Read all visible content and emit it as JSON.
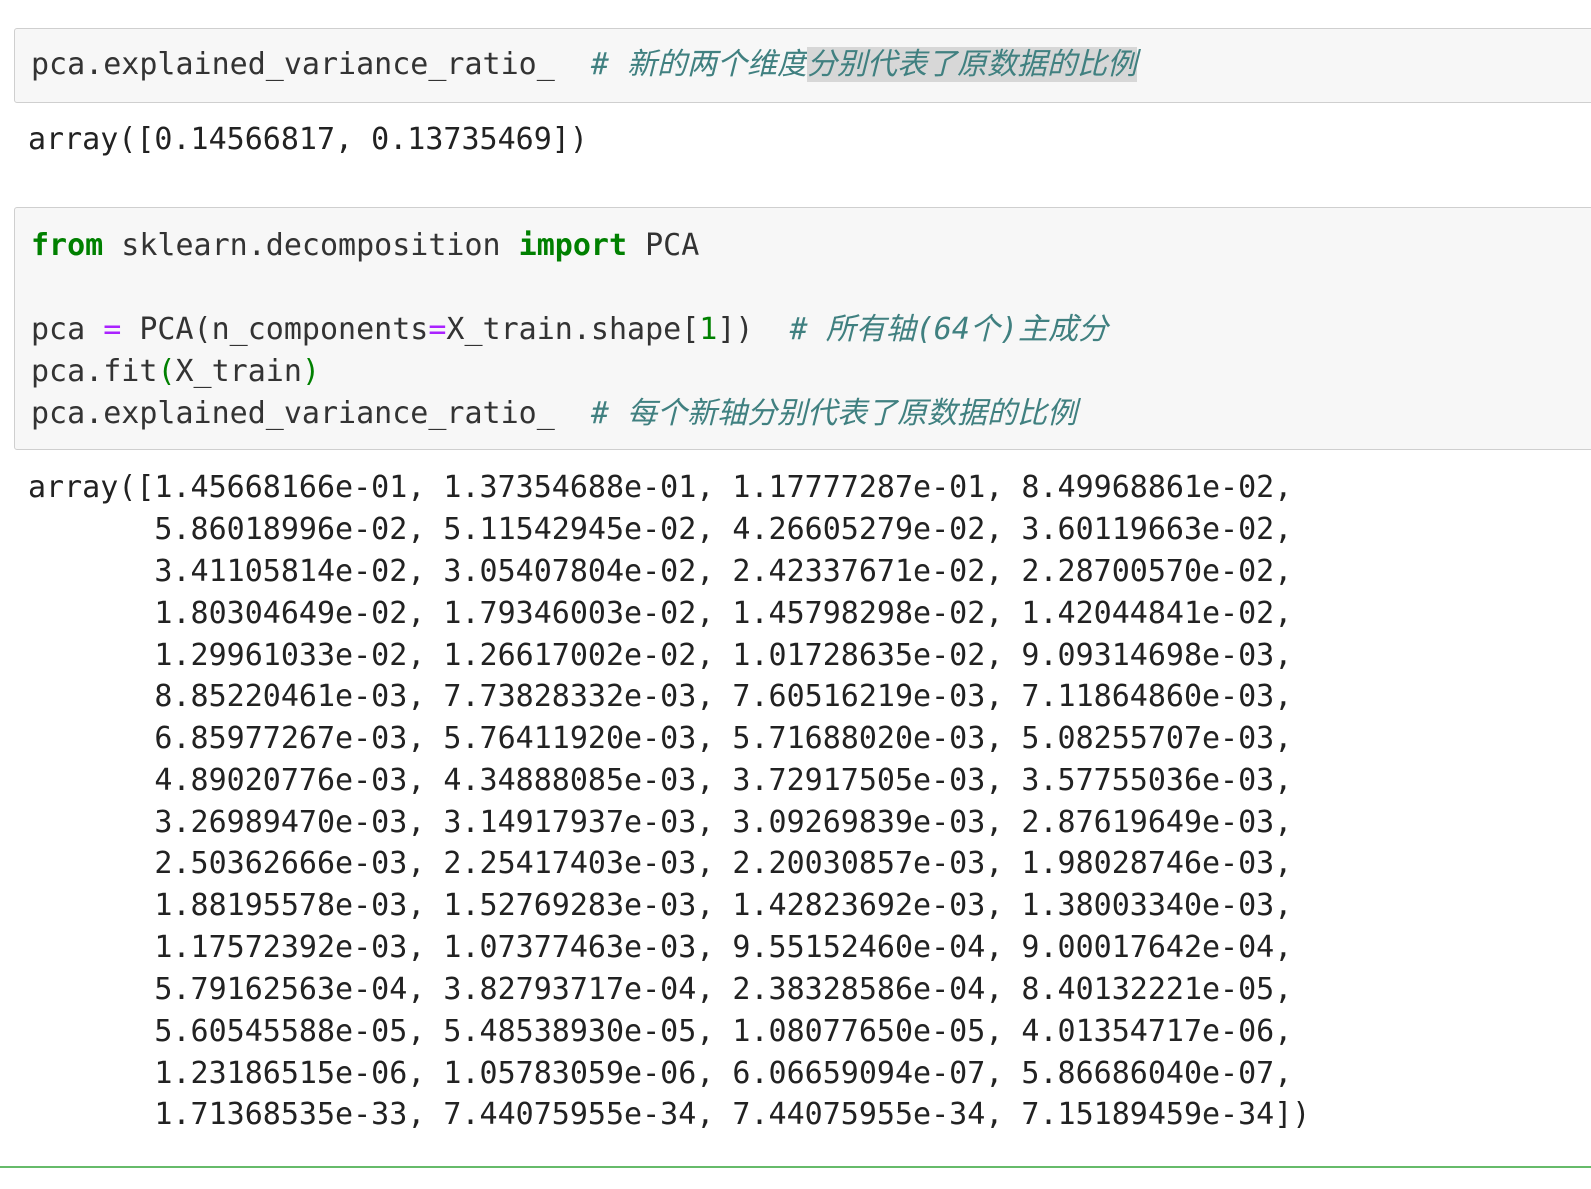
{
  "cell1": {
    "code": "pca.explained_variance_ratio_",
    "comment_prefix": "# 新的两个维度",
    "comment_selected": "分别代表了原数据的比例"
  },
  "output1": {
    "text": "array([0.14566817, 0.13735469])"
  },
  "cell2": {
    "line1": {
      "kw_from": "from",
      "module": " sklearn.decomposition ",
      "kw_import": "import",
      "name": " PCA"
    },
    "line2": {
      "lhs": "pca ",
      "eq": "=",
      "call_start": " PCA(n_components",
      "eq2": "=",
      "arg": "X_train.shape[",
      "index": "1",
      "call_end": "])  ",
      "comment": "# 所有轴(64个)主成分"
    },
    "line3": {
      "call": "pca.fit",
      "open": "(",
      "arg": "X_train",
      "close": ")"
    },
    "line4": {
      "code": "pca.explained_variance_ratio_  ",
      "comment": "# 每个新轴分别代表了原数据的比例"
    }
  },
  "output2": {
    "lines": [
      "array([1.45668166e-01, 1.37354688e-01, 1.17777287e-01, 8.49968861e-02,",
      "       5.86018996e-02, 5.11542945e-02, 4.26605279e-02, 3.60119663e-02,",
      "       3.41105814e-02, 3.05407804e-02, 2.42337671e-02, 2.28700570e-02,",
      "       1.80304649e-02, 1.79346003e-02, 1.45798298e-02, 1.42044841e-02,",
      "       1.29961033e-02, 1.26617002e-02, 1.01728635e-02, 9.09314698e-03,",
      "       8.85220461e-03, 7.73828332e-03, 7.60516219e-03, 7.11864860e-03,",
      "       6.85977267e-03, 5.76411920e-03, 5.71688020e-03, 5.08255707e-03,",
      "       4.89020776e-03, 4.34888085e-03, 3.72917505e-03, 3.57755036e-03,",
      "       3.26989470e-03, 3.14917937e-03, 3.09269839e-03, 2.87619649e-03,",
      "       2.50362666e-03, 2.25417403e-03, 2.20030857e-03, 1.98028746e-03,",
      "       1.88195578e-03, 1.52769283e-03, 1.42823692e-03, 1.38003340e-03,",
      "       1.17572392e-03, 1.07377463e-03, 9.55152460e-04, 9.00017642e-04,",
      "       5.79162563e-04, 3.82793717e-04, 2.38328586e-04, 8.40132221e-05,",
      "       5.60545588e-05, 5.48538930e-05, 1.08077650e-05, 4.01354717e-06,",
      "       1.23186515e-06, 1.05783059e-06, 6.06659094e-07, 5.86686040e-07,",
      "       1.71368535e-33, 7.44075955e-34, 7.44075955e-34, 7.15189459e-34])"
    ]
  }
}
